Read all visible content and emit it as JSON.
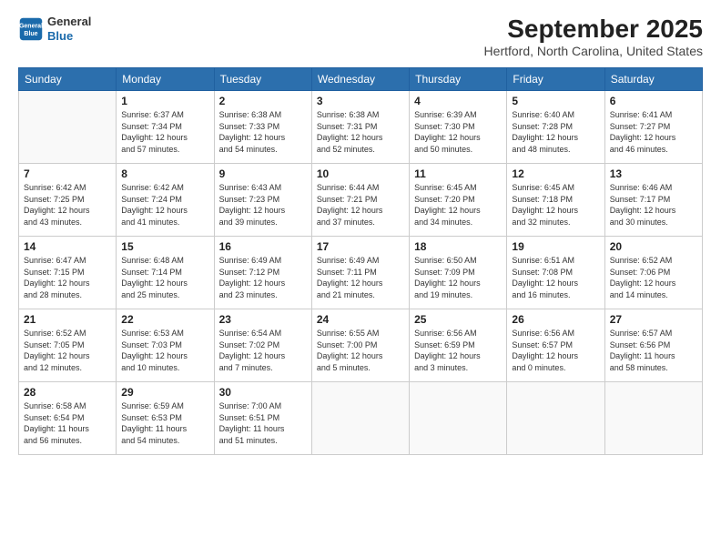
{
  "logo": {
    "line1": "General",
    "line2": "Blue"
  },
  "header": {
    "month": "September 2025",
    "location": "Hertford, North Carolina, United States"
  },
  "days_of_week": [
    "Sunday",
    "Monday",
    "Tuesday",
    "Wednesday",
    "Thursday",
    "Friday",
    "Saturday"
  ],
  "weeks": [
    [
      {
        "day": "",
        "content": ""
      },
      {
        "day": "1",
        "content": "Sunrise: 6:37 AM\nSunset: 7:34 PM\nDaylight: 12 hours\nand 57 minutes."
      },
      {
        "day": "2",
        "content": "Sunrise: 6:38 AM\nSunset: 7:33 PM\nDaylight: 12 hours\nand 54 minutes."
      },
      {
        "day": "3",
        "content": "Sunrise: 6:38 AM\nSunset: 7:31 PM\nDaylight: 12 hours\nand 52 minutes."
      },
      {
        "day": "4",
        "content": "Sunrise: 6:39 AM\nSunset: 7:30 PM\nDaylight: 12 hours\nand 50 minutes."
      },
      {
        "day": "5",
        "content": "Sunrise: 6:40 AM\nSunset: 7:28 PM\nDaylight: 12 hours\nand 48 minutes."
      },
      {
        "day": "6",
        "content": "Sunrise: 6:41 AM\nSunset: 7:27 PM\nDaylight: 12 hours\nand 46 minutes."
      }
    ],
    [
      {
        "day": "7",
        "content": "Sunrise: 6:42 AM\nSunset: 7:25 PM\nDaylight: 12 hours\nand 43 minutes."
      },
      {
        "day": "8",
        "content": "Sunrise: 6:42 AM\nSunset: 7:24 PM\nDaylight: 12 hours\nand 41 minutes."
      },
      {
        "day": "9",
        "content": "Sunrise: 6:43 AM\nSunset: 7:23 PM\nDaylight: 12 hours\nand 39 minutes."
      },
      {
        "day": "10",
        "content": "Sunrise: 6:44 AM\nSunset: 7:21 PM\nDaylight: 12 hours\nand 37 minutes."
      },
      {
        "day": "11",
        "content": "Sunrise: 6:45 AM\nSunset: 7:20 PM\nDaylight: 12 hours\nand 34 minutes."
      },
      {
        "day": "12",
        "content": "Sunrise: 6:45 AM\nSunset: 7:18 PM\nDaylight: 12 hours\nand 32 minutes."
      },
      {
        "day": "13",
        "content": "Sunrise: 6:46 AM\nSunset: 7:17 PM\nDaylight: 12 hours\nand 30 minutes."
      }
    ],
    [
      {
        "day": "14",
        "content": "Sunrise: 6:47 AM\nSunset: 7:15 PM\nDaylight: 12 hours\nand 28 minutes."
      },
      {
        "day": "15",
        "content": "Sunrise: 6:48 AM\nSunset: 7:14 PM\nDaylight: 12 hours\nand 25 minutes."
      },
      {
        "day": "16",
        "content": "Sunrise: 6:49 AM\nSunset: 7:12 PM\nDaylight: 12 hours\nand 23 minutes."
      },
      {
        "day": "17",
        "content": "Sunrise: 6:49 AM\nSunset: 7:11 PM\nDaylight: 12 hours\nand 21 minutes."
      },
      {
        "day": "18",
        "content": "Sunrise: 6:50 AM\nSunset: 7:09 PM\nDaylight: 12 hours\nand 19 minutes."
      },
      {
        "day": "19",
        "content": "Sunrise: 6:51 AM\nSunset: 7:08 PM\nDaylight: 12 hours\nand 16 minutes."
      },
      {
        "day": "20",
        "content": "Sunrise: 6:52 AM\nSunset: 7:06 PM\nDaylight: 12 hours\nand 14 minutes."
      }
    ],
    [
      {
        "day": "21",
        "content": "Sunrise: 6:52 AM\nSunset: 7:05 PM\nDaylight: 12 hours\nand 12 minutes."
      },
      {
        "day": "22",
        "content": "Sunrise: 6:53 AM\nSunset: 7:03 PM\nDaylight: 12 hours\nand 10 minutes."
      },
      {
        "day": "23",
        "content": "Sunrise: 6:54 AM\nSunset: 7:02 PM\nDaylight: 12 hours\nand 7 minutes."
      },
      {
        "day": "24",
        "content": "Sunrise: 6:55 AM\nSunset: 7:00 PM\nDaylight: 12 hours\nand 5 minutes."
      },
      {
        "day": "25",
        "content": "Sunrise: 6:56 AM\nSunset: 6:59 PM\nDaylight: 12 hours\nand 3 minutes."
      },
      {
        "day": "26",
        "content": "Sunrise: 6:56 AM\nSunset: 6:57 PM\nDaylight: 12 hours\nand 0 minutes."
      },
      {
        "day": "27",
        "content": "Sunrise: 6:57 AM\nSunset: 6:56 PM\nDaylight: 11 hours\nand 58 minutes."
      }
    ],
    [
      {
        "day": "28",
        "content": "Sunrise: 6:58 AM\nSunset: 6:54 PM\nDaylight: 11 hours\nand 56 minutes."
      },
      {
        "day": "29",
        "content": "Sunrise: 6:59 AM\nSunset: 6:53 PM\nDaylight: 11 hours\nand 54 minutes."
      },
      {
        "day": "30",
        "content": "Sunrise: 7:00 AM\nSunset: 6:51 PM\nDaylight: 11 hours\nand 51 minutes."
      },
      {
        "day": "",
        "content": ""
      },
      {
        "day": "",
        "content": ""
      },
      {
        "day": "",
        "content": ""
      },
      {
        "day": "",
        "content": ""
      }
    ]
  ]
}
